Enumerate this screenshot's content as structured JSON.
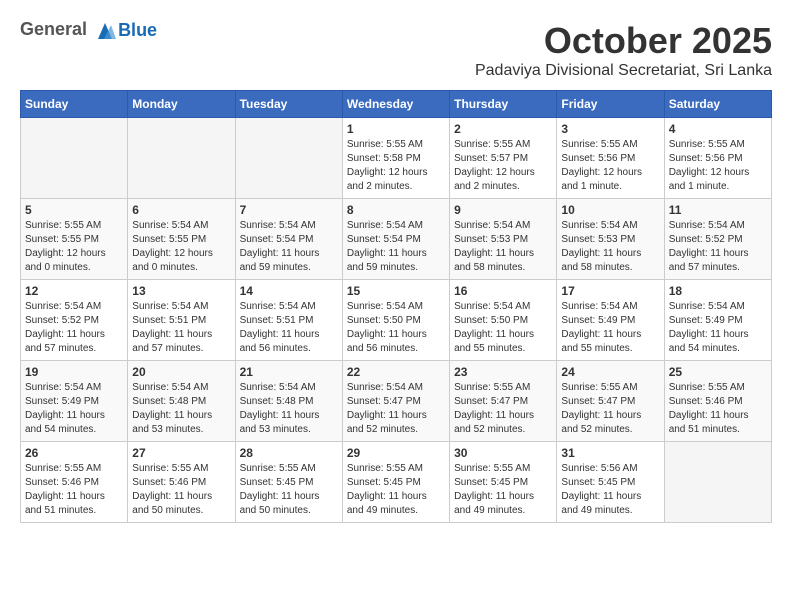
{
  "header": {
    "logo_line1": "General",
    "logo_line2": "Blue",
    "month": "October 2025",
    "location": "Padaviya Divisional Secretariat, Sri Lanka"
  },
  "weekdays": [
    "Sunday",
    "Monday",
    "Tuesday",
    "Wednesday",
    "Thursday",
    "Friday",
    "Saturday"
  ],
  "weeks": [
    [
      {
        "day": "",
        "info": ""
      },
      {
        "day": "",
        "info": ""
      },
      {
        "day": "",
        "info": ""
      },
      {
        "day": "1",
        "info": "Sunrise: 5:55 AM\nSunset: 5:58 PM\nDaylight: 12 hours and 2 minutes."
      },
      {
        "day": "2",
        "info": "Sunrise: 5:55 AM\nSunset: 5:57 PM\nDaylight: 12 hours and 2 minutes."
      },
      {
        "day": "3",
        "info": "Sunrise: 5:55 AM\nSunset: 5:56 PM\nDaylight: 12 hours and 1 minute."
      },
      {
        "day": "4",
        "info": "Sunrise: 5:55 AM\nSunset: 5:56 PM\nDaylight: 12 hours and 1 minute."
      }
    ],
    [
      {
        "day": "5",
        "info": "Sunrise: 5:55 AM\nSunset: 5:55 PM\nDaylight: 12 hours and 0 minutes."
      },
      {
        "day": "6",
        "info": "Sunrise: 5:54 AM\nSunset: 5:55 PM\nDaylight: 12 hours and 0 minutes."
      },
      {
        "day": "7",
        "info": "Sunrise: 5:54 AM\nSunset: 5:54 PM\nDaylight: 11 hours and 59 minutes."
      },
      {
        "day": "8",
        "info": "Sunrise: 5:54 AM\nSunset: 5:54 PM\nDaylight: 11 hours and 59 minutes."
      },
      {
        "day": "9",
        "info": "Sunrise: 5:54 AM\nSunset: 5:53 PM\nDaylight: 11 hours and 58 minutes."
      },
      {
        "day": "10",
        "info": "Sunrise: 5:54 AM\nSunset: 5:53 PM\nDaylight: 11 hours and 58 minutes."
      },
      {
        "day": "11",
        "info": "Sunrise: 5:54 AM\nSunset: 5:52 PM\nDaylight: 11 hours and 57 minutes."
      }
    ],
    [
      {
        "day": "12",
        "info": "Sunrise: 5:54 AM\nSunset: 5:52 PM\nDaylight: 11 hours and 57 minutes."
      },
      {
        "day": "13",
        "info": "Sunrise: 5:54 AM\nSunset: 5:51 PM\nDaylight: 11 hours and 57 minutes."
      },
      {
        "day": "14",
        "info": "Sunrise: 5:54 AM\nSunset: 5:51 PM\nDaylight: 11 hours and 56 minutes."
      },
      {
        "day": "15",
        "info": "Sunrise: 5:54 AM\nSunset: 5:50 PM\nDaylight: 11 hours and 56 minutes."
      },
      {
        "day": "16",
        "info": "Sunrise: 5:54 AM\nSunset: 5:50 PM\nDaylight: 11 hours and 55 minutes."
      },
      {
        "day": "17",
        "info": "Sunrise: 5:54 AM\nSunset: 5:49 PM\nDaylight: 11 hours and 55 minutes."
      },
      {
        "day": "18",
        "info": "Sunrise: 5:54 AM\nSunset: 5:49 PM\nDaylight: 11 hours and 54 minutes."
      }
    ],
    [
      {
        "day": "19",
        "info": "Sunrise: 5:54 AM\nSunset: 5:49 PM\nDaylight: 11 hours and 54 minutes."
      },
      {
        "day": "20",
        "info": "Sunrise: 5:54 AM\nSunset: 5:48 PM\nDaylight: 11 hours and 53 minutes."
      },
      {
        "day": "21",
        "info": "Sunrise: 5:54 AM\nSunset: 5:48 PM\nDaylight: 11 hours and 53 minutes."
      },
      {
        "day": "22",
        "info": "Sunrise: 5:54 AM\nSunset: 5:47 PM\nDaylight: 11 hours and 52 minutes."
      },
      {
        "day": "23",
        "info": "Sunrise: 5:55 AM\nSunset: 5:47 PM\nDaylight: 11 hours and 52 minutes."
      },
      {
        "day": "24",
        "info": "Sunrise: 5:55 AM\nSunset: 5:47 PM\nDaylight: 11 hours and 52 minutes."
      },
      {
        "day": "25",
        "info": "Sunrise: 5:55 AM\nSunset: 5:46 PM\nDaylight: 11 hours and 51 minutes."
      }
    ],
    [
      {
        "day": "26",
        "info": "Sunrise: 5:55 AM\nSunset: 5:46 PM\nDaylight: 11 hours and 51 minutes."
      },
      {
        "day": "27",
        "info": "Sunrise: 5:55 AM\nSunset: 5:46 PM\nDaylight: 11 hours and 50 minutes."
      },
      {
        "day": "28",
        "info": "Sunrise: 5:55 AM\nSunset: 5:45 PM\nDaylight: 11 hours and 50 minutes."
      },
      {
        "day": "29",
        "info": "Sunrise: 5:55 AM\nSunset: 5:45 PM\nDaylight: 11 hours and 49 minutes."
      },
      {
        "day": "30",
        "info": "Sunrise: 5:55 AM\nSunset: 5:45 PM\nDaylight: 11 hours and 49 minutes."
      },
      {
        "day": "31",
        "info": "Sunrise: 5:56 AM\nSunset: 5:45 PM\nDaylight: 11 hours and 49 minutes."
      },
      {
        "day": "",
        "info": ""
      }
    ]
  ]
}
